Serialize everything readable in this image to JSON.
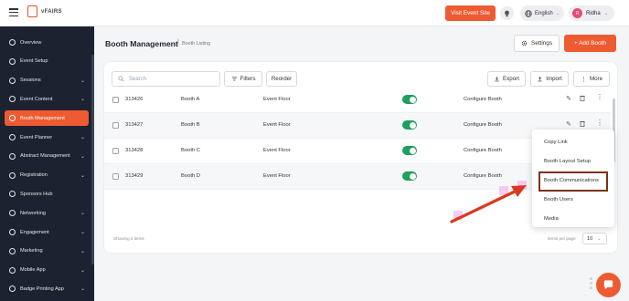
{
  "topbar": {
    "logo_text": "vFAIRS",
    "visit_event_label": "Visit Event Site",
    "language": "English",
    "user_initial": "R",
    "user_name": "Ridha"
  },
  "sidebar": {
    "items": [
      {
        "label": "Overview",
        "chevron": false,
        "active": false
      },
      {
        "label": "Event Setup",
        "chevron": false,
        "active": false
      },
      {
        "label": "Sessions",
        "chevron": true,
        "active": false
      },
      {
        "label": "Event Content",
        "chevron": true,
        "active": false
      },
      {
        "label": "Booth Management",
        "chevron": false,
        "active": true
      },
      {
        "label": "Event Planner",
        "chevron": true,
        "active": false
      },
      {
        "label": "Abstract Management",
        "chevron": true,
        "active": false
      },
      {
        "label": "Registration",
        "chevron": true,
        "active": false
      },
      {
        "label": "Sponsors Hub",
        "chevron": false,
        "active": false
      },
      {
        "label": "Networking",
        "chevron": true,
        "active": false
      },
      {
        "label": "Engagement",
        "chevron": true,
        "active": false
      },
      {
        "label": "Marketing",
        "chevron": true,
        "active": false
      },
      {
        "label": "Mobile App",
        "chevron": true,
        "active": false
      },
      {
        "label": "Badge Printing App",
        "chevron": true,
        "active": false
      }
    ]
  },
  "header": {
    "title": "Booth Management",
    "breadcrumb": "Booth Listing",
    "settings_label": "Settings",
    "add_label": "+ Add Booth"
  },
  "toolbar": {
    "search_placeholder": "Search",
    "filters_label": "Filters",
    "reorder_label": "Reorder",
    "export_label": "Export",
    "import_label": "Import",
    "more_label": "More"
  },
  "rows": [
    {
      "id": "313426",
      "name": "Booth A",
      "location": "Event Floor",
      "enabled": true,
      "action": "Configure Booth"
    },
    {
      "id": "313427",
      "name": "Booth B",
      "location": "Event Floor",
      "enabled": true,
      "action": "Configure Booth"
    },
    {
      "id": "313428",
      "name": "Booth C",
      "location": "Event Floor",
      "enabled": true,
      "action": "Configure Booth"
    },
    {
      "id": "313429",
      "name": "Booth D",
      "location": "Event Floor",
      "enabled": true,
      "action": "Configure Booth"
    }
  ],
  "context_menu": {
    "items": [
      "Copy Link",
      "Booth Layout Setup",
      "Booth Communications",
      "Booth Users",
      "Media"
    ],
    "highlighted": "Booth Communications"
  },
  "footer": {
    "showing": "Showing 4 items",
    "items_per_page_label": "Items per page",
    "items_per_page_value": "10"
  },
  "colors": {
    "accent": "#ee5b32",
    "sidebar_bg": "#1c2230",
    "toggle_on": "#1e9f5c",
    "highlight_box": "#7a3410",
    "arrow": "#d93a1f"
  }
}
